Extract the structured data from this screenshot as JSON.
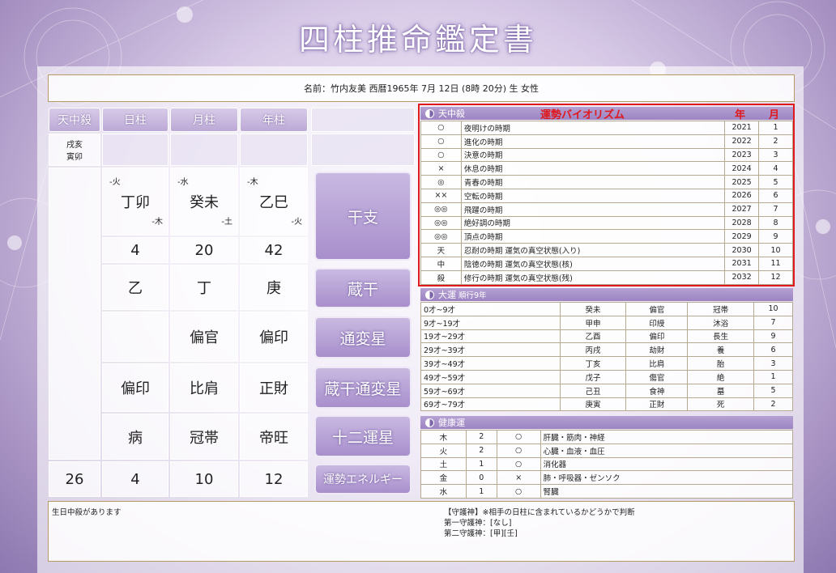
{
  "title": "四柱推命鑑定書",
  "name_line": "名前：竹内友美 西暦1965年 7月 12日 (8時 20分) 生 女性",
  "headers": [
    "天中殺",
    "日柱",
    "月柱",
    "年柱"
  ],
  "tenchusatsu": [
    "戌亥",
    "寅卯"
  ],
  "pillars": [
    {
      "top": "-火",
      "kanshi": "丁卯",
      "bottom": "-木",
      "num": "4",
      "zoukan": "乙",
      "tsuhen": "",
      "zoukan_tsuhen": "偏印",
      "unsei": "病",
      "energy": "4"
    },
    {
      "top": "-水",
      "kanshi": "癸未",
      "bottom": "-土",
      "num": "20",
      "zoukan": "丁",
      "tsuhen": "偏官",
      "zoukan_tsuhen": "比肩",
      "unsei": "冠帯",
      "energy": "10"
    },
    {
      "top": "-木",
      "kanshi": "乙巳",
      "bottom": "-火",
      "num": "42",
      "zoukan": "庚",
      "tsuhen": "偏印",
      "zoukan_tsuhen": "正財",
      "unsei": "帝旺",
      "energy": "12"
    }
  ],
  "total_energy": "26",
  "labels": [
    "干支",
    "蔵干",
    "通変星",
    "蔵干通変星",
    "十二運星",
    "運勢エネルギー"
  ],
  "tenchu": {
    "header": "天中殺",
    "title": "運勢バイオリズム",
    "col_year": "年",
    "col_month": "月",
    "rows": [
      [
        "○",
        "夜明けの時期",
        "2021",
        "1"
      ],
      [
        "○",
        "進化の時期",
        "2022",
        "2"
      ],
      [
        "○",
        "決意の時期",
        "2023",
        "3"
      ],
      [
        "×",
        "休息の時期",
        "2024",
        "4"
      ],
      [
        "◎",
        "青春の時期",
        "2025",
        "5"
      ],
      [
        "××",
        "空転の時期",
        "2026",
        "6"
      ],
      [
        "◎◎",
        "飛躍の時期",
        "2027",
        "7"
      ],
      [
        "◎◎",
        "絶好調の時期",
        "2028",
        "8"
      ],
      [
        "◎◎",
        "頂点の時期",
        "2029",
        "9"
      ],
      [
        "天",
        "忍耐の時期 運気の真空状態(入り)",
        "2030",
        "10"
      ],
      [
        "中",
        "陰徳の時期 運気の真空状態(核)",
        "2031",
        "11"
      ],
      [
        "殺",
        "修行の時期 運気の真空状態(残)",
        "2032",
        "12"
      ]
    ]
  },
  "taiun": {
    "header": "大運",
    "sub": "順行9年",
    "rows": [
      [
        "0才~9才",
        "癸未",
        "偏官",
        "冠帯",
        "10"
      ],
      [
        "9才~19才",
        "甲申",
        "印綬",
        "沐浴",
        "7"
      ],
      [
        "19才~29才",
        "乙酉",
        "偏印",
        "長生",
        "9"
      ],
      [
        "29才~39才",
        "丙戌",
        "劫財",
        "養",
        "6"
      ],
      [
        "39才~49才",
        "丁亥",
        "比肩",
        "胎",
        "3"
      ],
      [
        "49才~59才",
        "戊子",
        "傷官",
        "絶",
        "1"
      ],
      [
        "59才~69才",
        "己丑",
        "食神",
        "墓",
        "5"
      ],
      [
        "69才~79才",
        "庚寅",
        "正財",
        "死",
        "2"
      ]
    ]
  },
  "kenko": {
    "header": "健康運",
    "rows": [
      [
        "木",
        "2",
        "○",
        "肝臓・筋肉・神経"
      ],
      [
        "火",
        "2",
        "○",
        "心臓・血液・血圧"
      ],
      [
        "土",
        "1",
        "○",
        "消化器"
      ],
      [
        "金",
        "0",
        "×",
        "肺・呼吸器・ゼンソク"
      ],
      [
        "水",
        "1",
        "○",
        "腎臓"
      ]
    ]
  },
  "notes": {
    "left": "生日中殺があります",
    "shugo": "【守護神】※相手の日柱に含まれているかどうかで判断",
    "first": "第一守護神：[なし]",
    "second": "第二守護神：[甲][壬]"
  }
}
